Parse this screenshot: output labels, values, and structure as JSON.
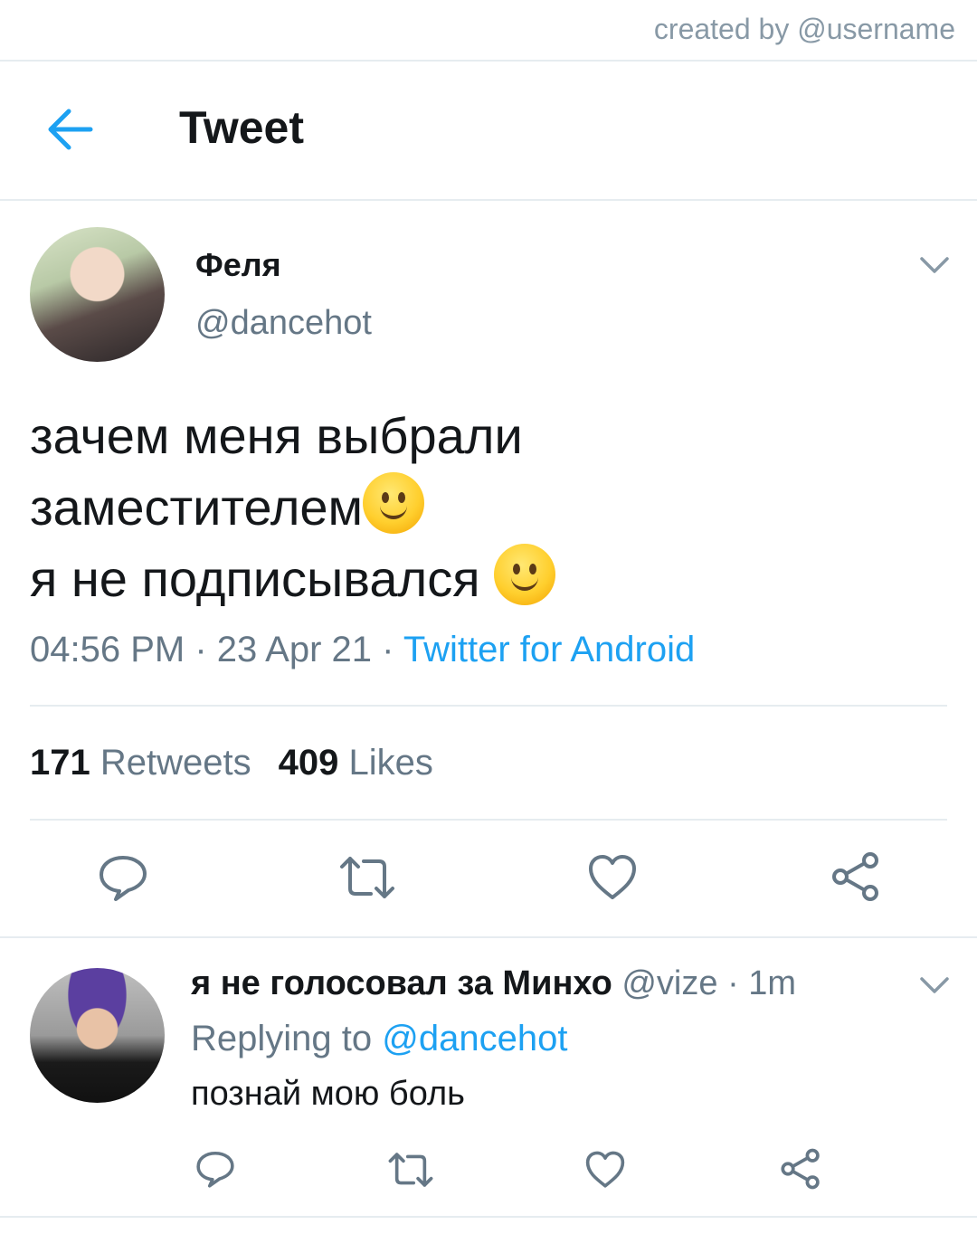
{
  "credit": "created by @username",
  "header": {
    "title": "Tweet",
    "back_icon": "arrow-left-icon"
  },
  "tweet": {
    "author_name": "Феля",
    "author_handle": "@dancehot",
    "text_lines": [
      "зачем меня выбрали",
      "заместителем",
      "я не подписывался "
    ],
    "emoji": "slightly-smiling-face",
    "time": "04:56 PM",
    "date": "23 Apr 21",
    "separator": " · ",
    "source": "Twitter for Android",
    "retweets_count": "171",
    "retweets_label": "Retweets",
    "likes_count": "409",
    "likes_label": "Likes"
  },
  "reply": {
    "author_name": "я не голосовал за Минхо",
    "author_handle": "@vize",
    "time_ago": "· 1m",
    "replying_label": "Replying to",
    "replying_mention": "@dancehot",
    "text": "познай мою боль"
  },
  "colors": {
    "accent": "#1da1f2",
    "secondary_text": "#657786",
    "divider": "#e6ecf0",
    "icon": "#657786"
  },
  "actions": [
    "reply-icon",
    "retweet-icon",
    "like-icon",
    "share-icon"
  ]
}
